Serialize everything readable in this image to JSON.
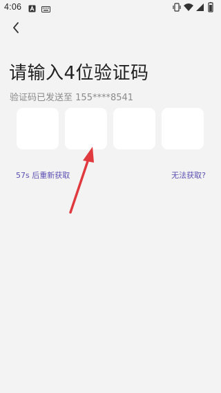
{
  "status_bar": {
    "time": "4:06",
    "left_icons": [
      "app-notification-icon",
      "keyboard-icon"
    ],
    "right_icons": [
      "vibrate-icon",
      "wifi-icon",
      "signal-icon",
      "battery-icon"
    ]
  },
  "header": {
    "back_icon": "chevron-left-icon"
  },
  "main": {
    "title": "请输入4位验证码",
    "subtitle_prefix": "验证码已发送至",
    "phone": "155****8541",
    "code_digits": [
      "",
      "",
      "",
      ""
    ],
    "resend_label": "57s 后重新获取",
    "cannot_get_label": "无法获取?"
  },
  "colors": {
    "background": "#f3f3f3",
    "box": "#ffffff",
    "link": "#5b4fb3",
    "arrow": "#e0393e"
  }
}
